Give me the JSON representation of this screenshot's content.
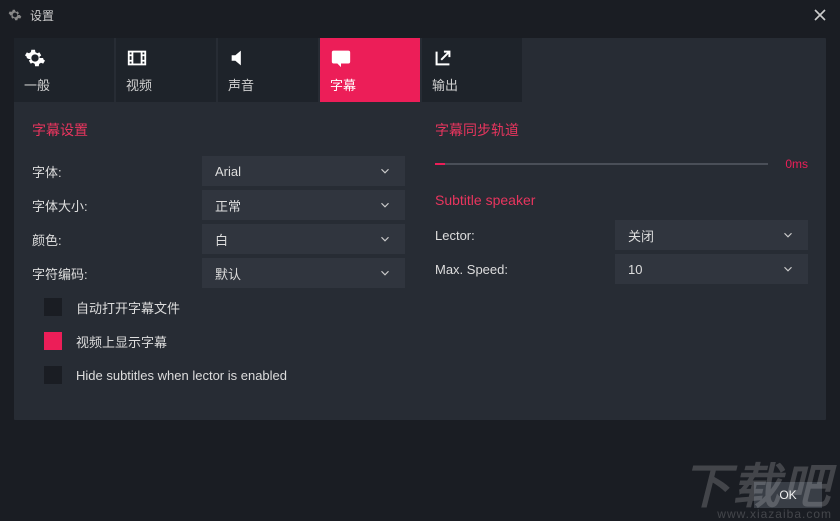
{
  "window": {
    "title": "设置"
  },
  "tabs": {
    "general": "一般",
    "video": "视频",
    "audio": "声音",
    "subtitle": "字幕",
    "output": "输出"
  },
  "left": {
    "section_title": "字幕设置",
    "font_label": "字体:",
    "font_value": "Arial",
    "size_label": "字体大小:",
    "size_value": "正常",
    "color_label": "颜色:",
    "color_value": "白",
    "encoding_label": "字符编码:",
    "encoding_value": "默认",
    "auto_open": "自动打开字幕文件",
    "show_on_video": "视频上显示字幕",
    "hide_when_lector": "Hide subtitles when lector is enabled"
  },
  "right": {
    "section_title": "字幕同步轨道",
    "slider_value": "0ms",
    "speaker_title": "Subtitle speaker",
    "lector_label": "Lector:",
    "lector_value": "关闭",
    "maxspeed_label": "Max. Speed:",
    "maxspeed_value": "10"
  },
  "footer": {
    "ok": "OK"
  },
  "watermark": {
    "big": "下载吧",
    "small": "www.xiazaiba.com"
  }
}
